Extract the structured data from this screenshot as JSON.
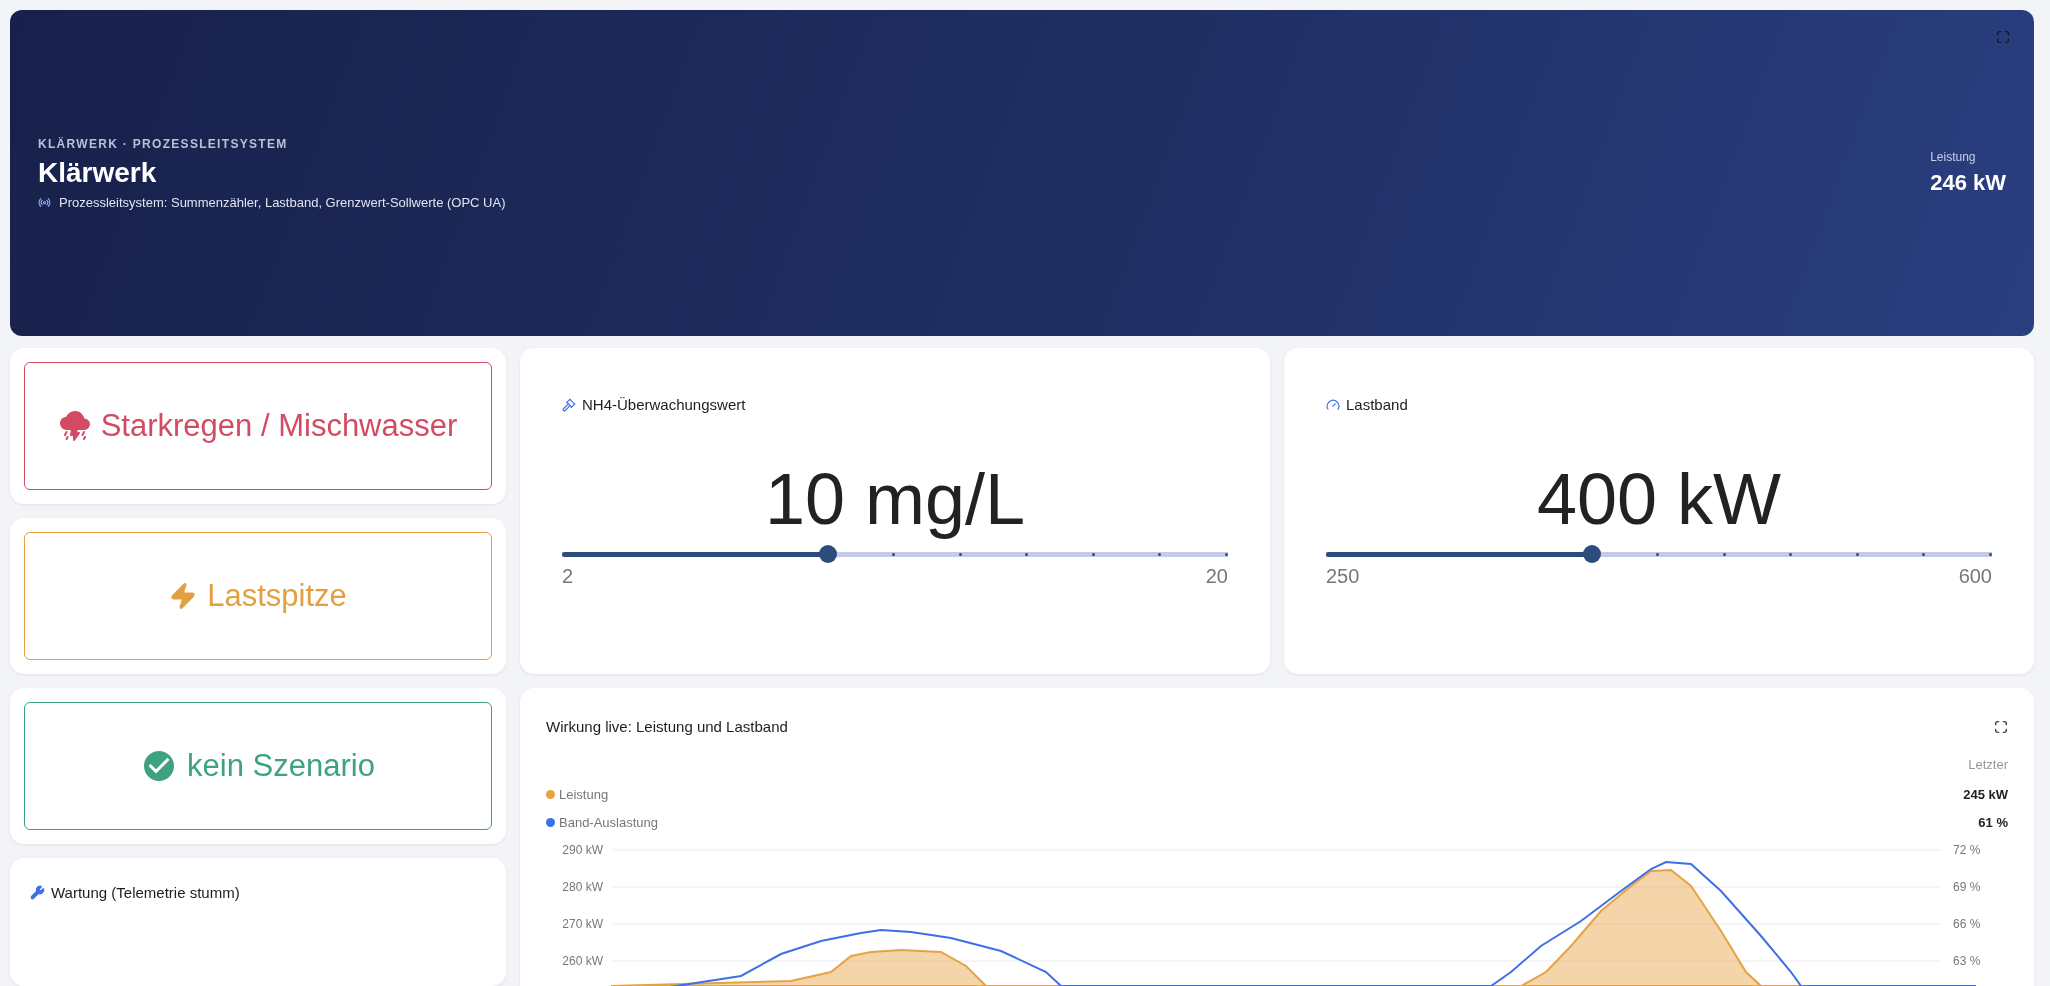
{
  "header": {
    "kicker": "KLÄRWERK · PROZESSLEITSYSTEM",
    "title": "Klärwerk",
    "subtitle": "Prozessleitsystem: Summenzähler, Lastband, Grenzwert-Sollwerte (OPC UA)",
    "metric_label": "Leistung",
    "metric_value": "246 kW"
  },
  "scenarios": [
    {
      "kind": "storm",
      "label": "Starkregen / Mischwasser",
      "color": "#d24b63"
    },
    {
      "kind": "peak",
      "label": "Lastspitze",
      "color": "#e3a041"
    },
    {
      "kind": "ok",
      "label": "kein Szenario",
      "color": "#3da37f"
    }
  ],
  "maintenance": {
    "title": "Wartung (Telemetrie stumm)"
  },
  "setpoints": [
    {
      "kind": "limit",
      "title": "NH4-Überwachungswert",
      "value": "10 mg/L",
      "level": 0.4,
      "min": "2",
      "max": "20"
    },
    {
      "kind": "band",
      "title": "Lastband",
      "value": "400 kW",
      "level": 0.4,
      "min": "250",
      "max": "600"
    }
  ],
  "chart": {
    "title": "Wirkung live: Leistung und Lastband",
    "last_header": "Letzter",
    "legend": [
      {
        "name": "Leistung",
        "color": "#e6a243",
        "last": "245 kW"
      },
      {
        "name": "Band-Auslastung",
        "color": "#3d6fe8",
        "last": "61 %"
      }
    ],
    "left_axis_ticks": [
      "290 kW",
      "280 kW",
      "270 kW",
      "260 kW"
    ],
    "right_axis_ticks": [
      "72 %",
      "69 %",
      "66 %",
      "63 %"
    ]
  }
}
